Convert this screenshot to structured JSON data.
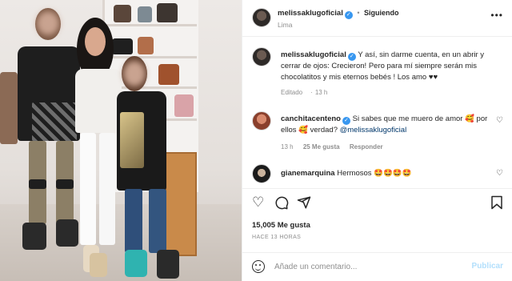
{
  "header": {
    "username": "melissaklugoficial",
    "separator": "•",
    "follow_status": "Siguiendo",
    "location": "Lima",
    "more_icon": "more-options-icon"
  },
  "caption": {
    "username": "melissaklugoficial",
    "text": "Y así, sin darme cuenta, en un abrir y cerrar de ojos: Crecieron! Pero para mí siempre serán mis chocolatitos y mis eternos bebés ! Los amo ♥♥",
    "edited": "Editado",
    "time": "13 h"
  },
  "comments": [
    {
      "username": "canchitacenteno",
      "text": "Si sabes que me muero de amor 🥰 por ellos 🥰 verdad?",
      "mention": "@melissaklugoficial",
      "time": "13 h",
      "likes": "25 Me gusta",
      "reply": "Responder"
    },
    {
      "username": "gianemarquina",
      "text": "Hermosos 🤩🤩🤩🤩"
    }
  ],
  "actions": {
    "like_icon": "heart-icon",
    "comment_icon": "comment-icon",
    "share_icon": "share-icon",
    "save_icon": "bookmark-icon"
  },
  "likes": "15,005 Me gusta",
  "timestamp": "HACE 13 HORAS",
  "add_comment": {
    "placeholder": "Añade un comentario...",
    "publish": "Publicar"
  }
}
